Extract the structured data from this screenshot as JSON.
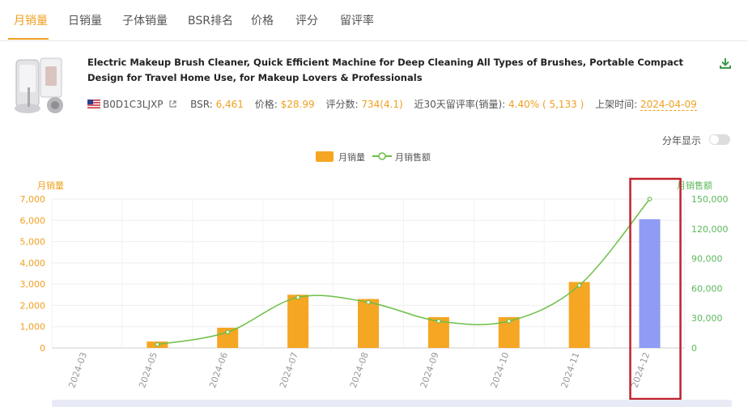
{
  "tabs": [
    "月销量",
    "日销量",
    "子体销量",
    "BSR排名",
    "价格",
    "评分",
    "留评率"
  ],
  "active_tab": 0,
  "product": {
    "title": "Electric Makeup Brush Cleaner, Quick Efficient Machine for Deep Cleaning All Types of Brushes, Portable Compact Design for Travel Home Use, for Makeup Lovers & Professionals",
    "asin": "B0D1C3LJXP",
    "bsr_label": "BSR:",
    "bsr_value": "6,461",
    "price_label": "价格:",
    "price_value": "$28.99",
    "rating_label": "评分数:",
    "rating_value": "734(4.1)",
    "review_rate_label": "近30天留评率(销量):",
    "review_rate_value": "4.40% ( 5,133 )",
    "listed_label": "上架时间:",
    "listed_value": "2024-04-09"
  },
  "toggle": {
    "label": "分年显示",
    "on": false
  },
  "legend": {
    "bar": "月销量",
    "line": "月销售额"
  },
  "colors": {
    "accent": "#f0a020",
    "bar": "#f5a623",
    "bar_highlight": "#8f9bf5",
    "line": "#6cbf45",
    "highlight_box": "#c0222e"
  },
  "chart_data": {
    "type": "bar",
    "categories": [
      "2024-03",
      "2024-05",
      "2024-06",
      "2024-07",
      "2024-08",
      "2024-09",
      "2024-10",
      "2024-11",
      "2024-12"
    ],
    "ylabel": "月销量",
    "ylabel_right": "月销售额",
    "ylim": [
      0,
      7000
    ],
    "ylim_right": [
      0,
      150000
    ],
    "yticks": [
      "0",
      "1,000",
      "2,000",
      "3,000",
      "4,000",
      "5,000",
      "6,000",
      "7,000"
    ],
    "yticks_right": [
      "0",
      "30,000",
      "60,000",
      "90,000",
      "120,000",
      "150,000"
    ],
    "series": [
      {
        "name": "月销量",
        "type": "bar",
        "values": [
          0,
          300,
          950,
          2500,
          2300,
          1450,
          1450,
          3100,
          6050
        ]
      },
      {
        "name": "月销售额",
        "type": "line",
        "values": [
          null,
          3500,
          16000,
          51000,
          46000,
          27000,
          27000,
          63000,
          150000
        ]
      }
    ],
    "highlight_category": "2024-12"
  }
}
